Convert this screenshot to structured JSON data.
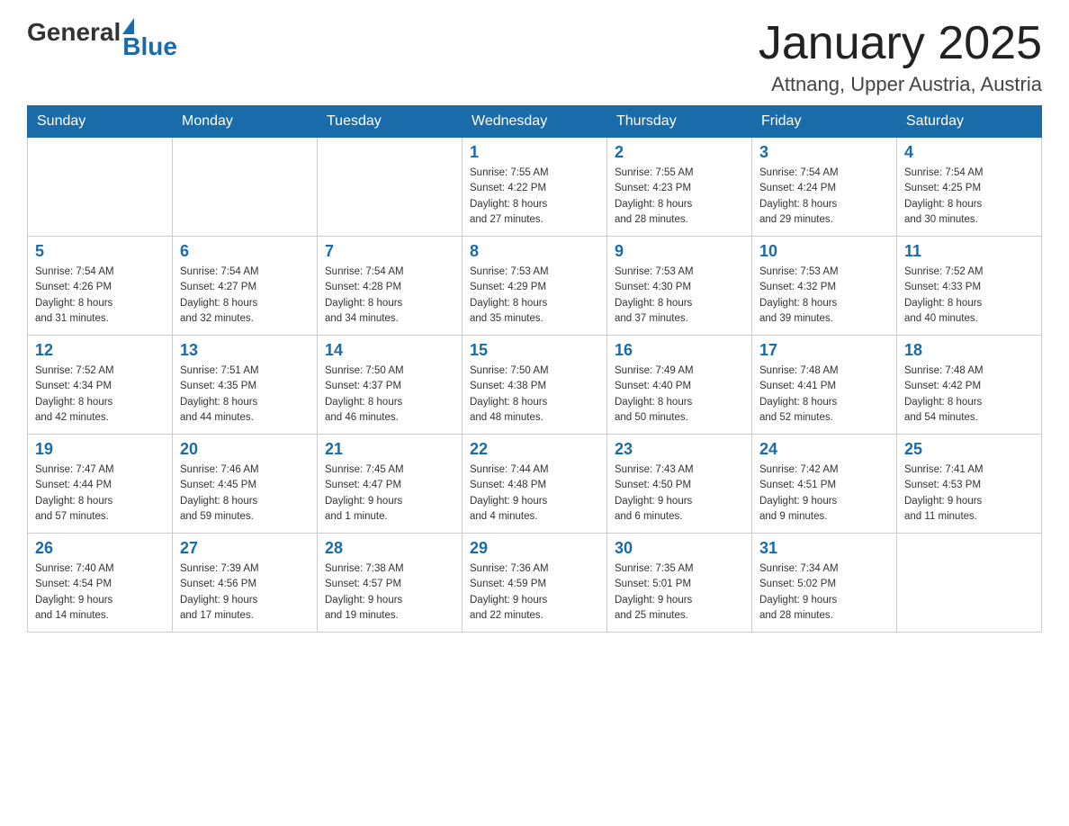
{
  "header": {
    "title": "January 2025",
    "subtitle": "Attnang, Upper Austria, Austria",
    "logo_general": "General",
    "logo_blue": "Blue"
  },
  "weekdays": [
    "Sunday",
    "Monday",
    "Tuesday",
    "Wednesday",
    "Thursday",
    "Friday",
    "Saturday"
  ],
  "weeks": [
    [
      {
        "day": "",
        "info": ""
      },
      {
        "day": "",
        "info": ""
      },
      {
        "day": "",
        "info": ""
      },
      {
        "day": "1",
        "info": "Sunrise: 7:55 AM\nSunset: 4:22 PM\nDaylight: 8 hours\nand 27 minutes."
      },
      {
        "day": "2",
        "info": "Sunrise: 7:55 AM\nSunset: 4:23 PM\nDaylight: 8 hours\nand 28 minutes."
      },
      {
        "day": "3",
        "info": "Sunrise: 7:54 AM\nSunset: 4:24 PM\nDaylight: 8 hours\nand 29 minutes."
      },
      {
        "day": "4",
        "info": "Sunrise: 7:54 AM\nSunset: 4:25 PM\nDaylight: 8 hours\nand 30 minutes."
      }
    ],
    [
      {
        "day": "5",
        "info": "Sunrise: 7:54 AM\nSunset: 4:26 PM\nDaylight: 8 hours\nand 31 minutes."
      },
      {
        "day": "6",
        "info": "Sunrise: 7:54 AM\nSunset: 4:27 PM\nDaylight: 8 hours\nand 32 minutes."
      },
      {
        "day": "7",
        "info": "Sunrise: 7:54 AM\nSunset: 4:28 PM\nDaylight: 8 hours\nand 34 minutes."
      },
      {
        "day": "8",
        "info": "Sunrise: 7:53 AM\nSunset: 4:29 PM\nDaylight: 8 hours\nand 35 minutes."
      },
      {
        "day": "9",
        "info": "Sunrise: 7:53 AM\nSunset: 4:30 PM\nDaylight: 8 hours\nand 37 minutes."
      },
      {
        "day": "10",
        "info": "Sunrise: 7:53 AM\nSunset: 4:32 PM\nDaylight: 8 hours\nand 39 minutes."
      },
      {
        "day": "11",
        "info": "Sunrise: 7:52 AM\nSunset: 4:33 PM\nDaylight: 8 hours\nand 40 minutes."
      }
    ],
    [
      {
        "day": "12",
        "info": "Sunrise: 7:52 AM\nSunset: 4:34 PM\nDaylight: 8 hours\nand 42 minutes."
      },
      {
        "day": "13",
        "info": "Sunrise: 7:51 AM\nSunset: 4:35 PM\nDaylight: 8 hours\nand 44 minutes."
      },
      {
        "day": "14",
        "info": "Sunrise: 7:50 AM\nSunset: 4:37 PM\nDaylight: 8 hours\nand 46 minutes."
      },
      {
        "day": "15",
        "info": "Sunrise: 7:50 AM\nSunset: 4:38 PM\nDaylight: 8 hours\nand 48 minutes."
      },
      {
        "day": "16",
        "info": "Sunrise: 7:49 AM\nSunset: 4:40 PM\nDaylight: 8 hours\nand 50 minutes."
      },
      {
        "day": "17",
        "info": "Sunrise: 7:48 AM\nSunset: 4:41 PM\nDaylight: 8 hours\nand 52 minutes."
      },
      {
        "day": "18",
        "info": "Sunrise: 7:48 AM\nSunset: 4:42 PM\nDaylight: 8 hours\nand 54 minutes."
      }
    ],
    [
      {
        "day": "19",
        "info": "Sunrise: 7:47 AM\nSunset: 4:44 PM\nDaylight: 8 hours\nand 57 minutes."
      },
      {
        "day": "20",
        "info": "Sunrise: 7:46 AM\nSunset: 4:45 PM\nDaylight: 8 hours\nand 59 minutes."
      },
      {
        "day": "21",
        "info": "Sunrise: 7:45 AM\nSunset: 4:47 PM\nDaylight: 9 hours\nand 1 minute."
      },
      {
        "day": "22",
        "info": "Sunrise: 7:44 AM\nSunset: 4:48 PM\nDaylight: 9 hours\nand 4 minutes."
      },
      {
        "day": "23",
        "info": "Sunrise: 7:43 AM\nSunset: 4:50 PM\nDaylight: 9 hours\nand 6 minutes."
      },
      {
        "day": "24",
        "info": "Sunrise: 7:42 AM\nSunset: 4:51 PM\nDaylight: 9 hours\nand 9 minutes."
      },
      {
        "day": "25",
        "info": "Sunrise: 7:41 AM\nSunset: 4:53 PM\nDaylight: 9 hours\nand 11 minutes."
      }
    ],
    [
      {
        "day": "26",
        "info": "Sunrise: 7:40 AM\nSunset: 4:54 PM\nDaylight: 9 hours\nand 14 minutes."
      },
      {
        "day": "27",
        "info": "Sunrise: 7:39 AM\nSunset: 4:56 PM\nDaylight: 9 hours\nand 17 minutes."
      },
      {
        "day": "28",
        "info": "Sunrise: 7:38 AM\nSunset: 4:57 PM\nDaylight: 9 hours\nand 19 minutes."
      },
      {
        "day": "29",
        "info": "Sunrise: 7:36 AM\nSunset: 4:59 PM\nDaylight: 9 hours\nand 22 minutes."
      },
      {
        "day": "30",
        "info": "Sunrise: 7:35 AM\nSunset: 5:01 PM\nDaylight: 9 hours\nand 25 minutes."
      },
      {
        "day": "31",
        "info": "Sunrise: 7:34 AM\nSunset: 5:02 PM\nDaylight: 9 hours\nand 28 minutes."
      },
      {
        "day": "",
        "info": ""
      }
    ]
  ]
}
